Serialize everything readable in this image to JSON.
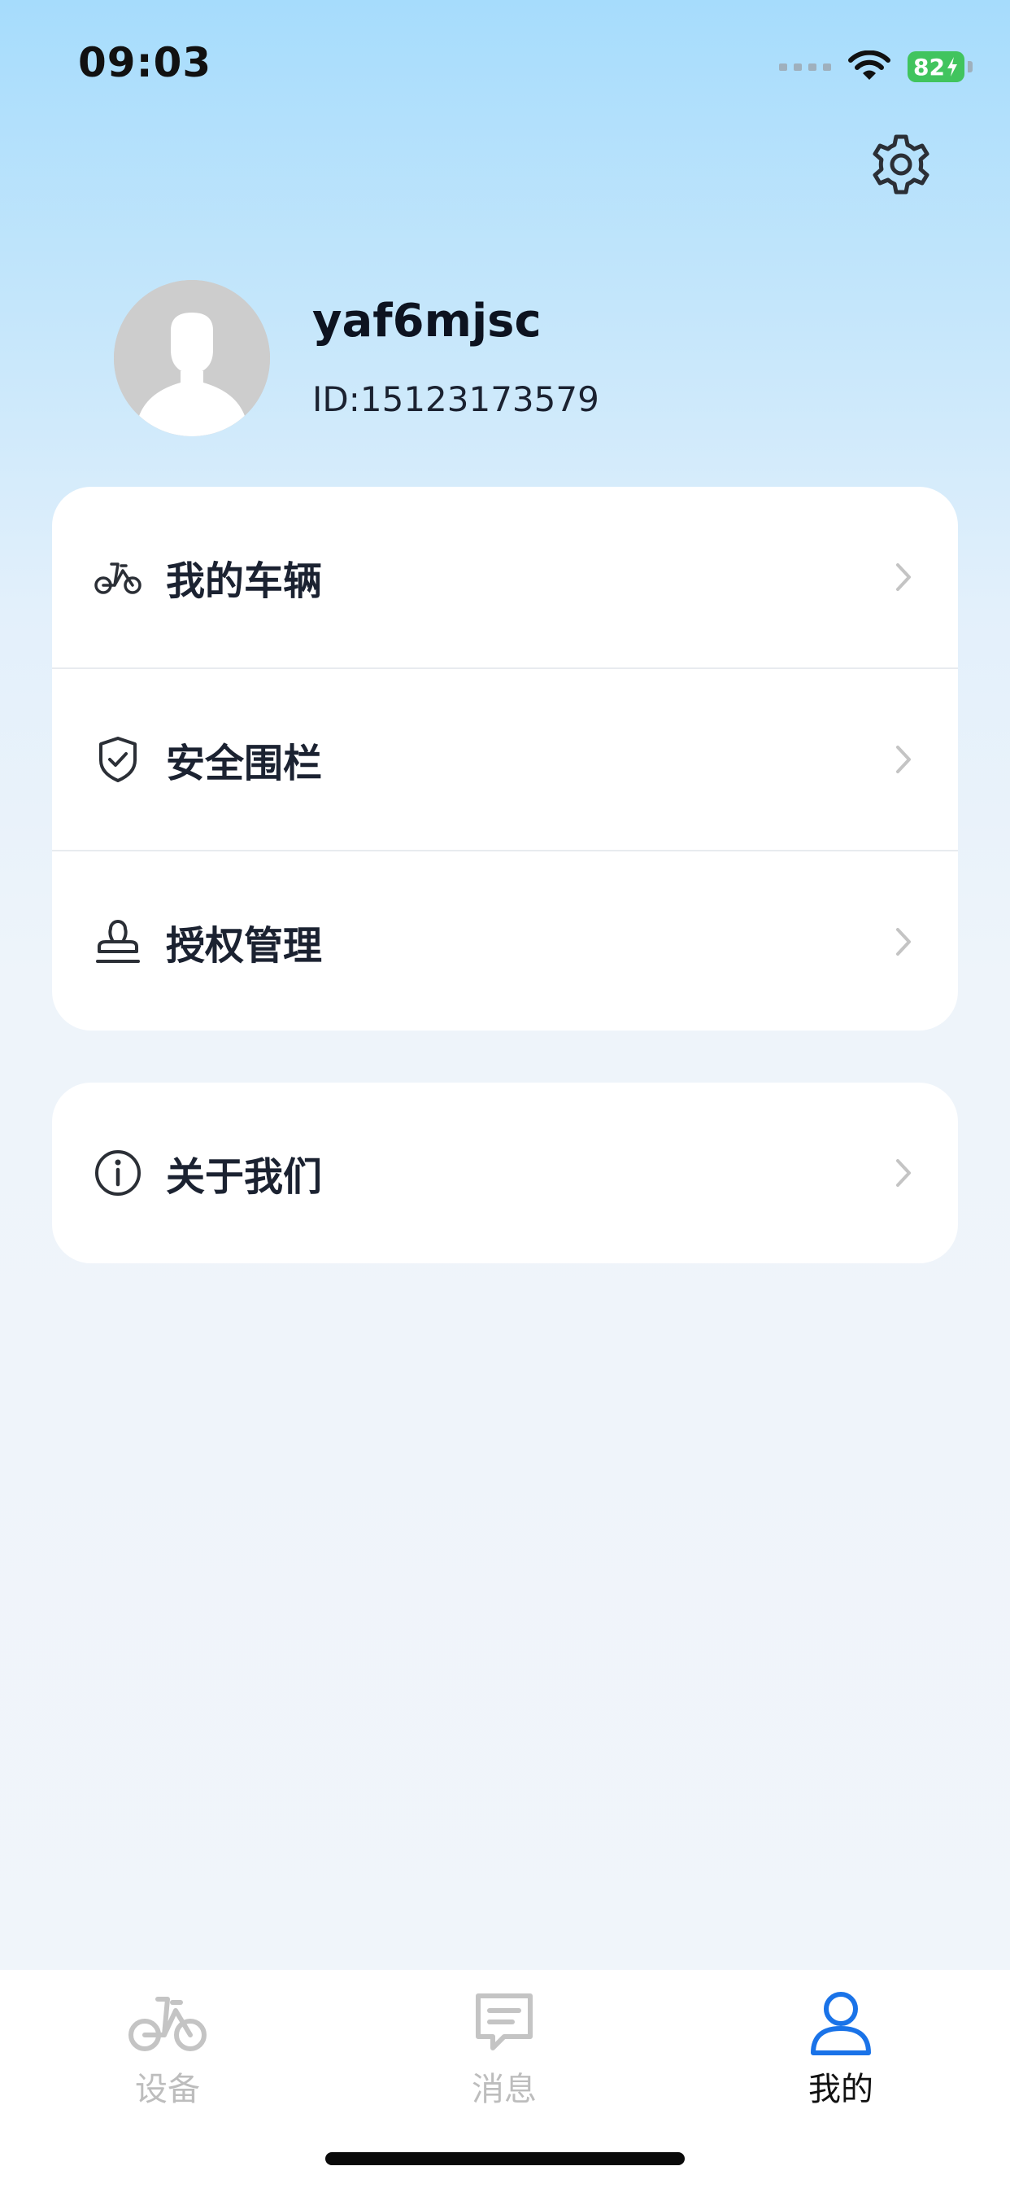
{
  "status_bar": {
    "time": "09:03",
    "battery": "82"
  },
  "header": {
    "settings_icon": "gear-icon"
  },
  "profile": {
    "username": "yaf6mjsc",
    "id_text": "ID:15123173579",
    "avatar_icon": "default-avatar-icon"
  },
  "menu": {
    "group1": [
      {
        "label": "我的车辆",
        "icon": "bike-icon"
      },
      {
        "label": "安全围栏",
        "icon": "shield-check-icon"
      },
      {
        "label": "授权管理",
        "icon": "stamp-icon"
      }
    ],
    "group2": [
      {
        "label": "关于我们",
        "icon": "info-icon"
      }
    ]
  },
  "tabbar": {
    "tabs": [
      {
        "label": "设备",
        "icon": "bike-icon",
        "active": false
      },
      {
        "label": "消息",
        "icon": "message-icon",
        "active": false
      },
      {
        "label": "我的",
        "icon": "person-icon",
        "active": true
      }
    ]
  },
  "colors": {
    "accent": "#1a73e8",
    "inactive": "#bdbdbd",
    "text": "#1b2231",
    "battery": "#41c45e"
  }
}
